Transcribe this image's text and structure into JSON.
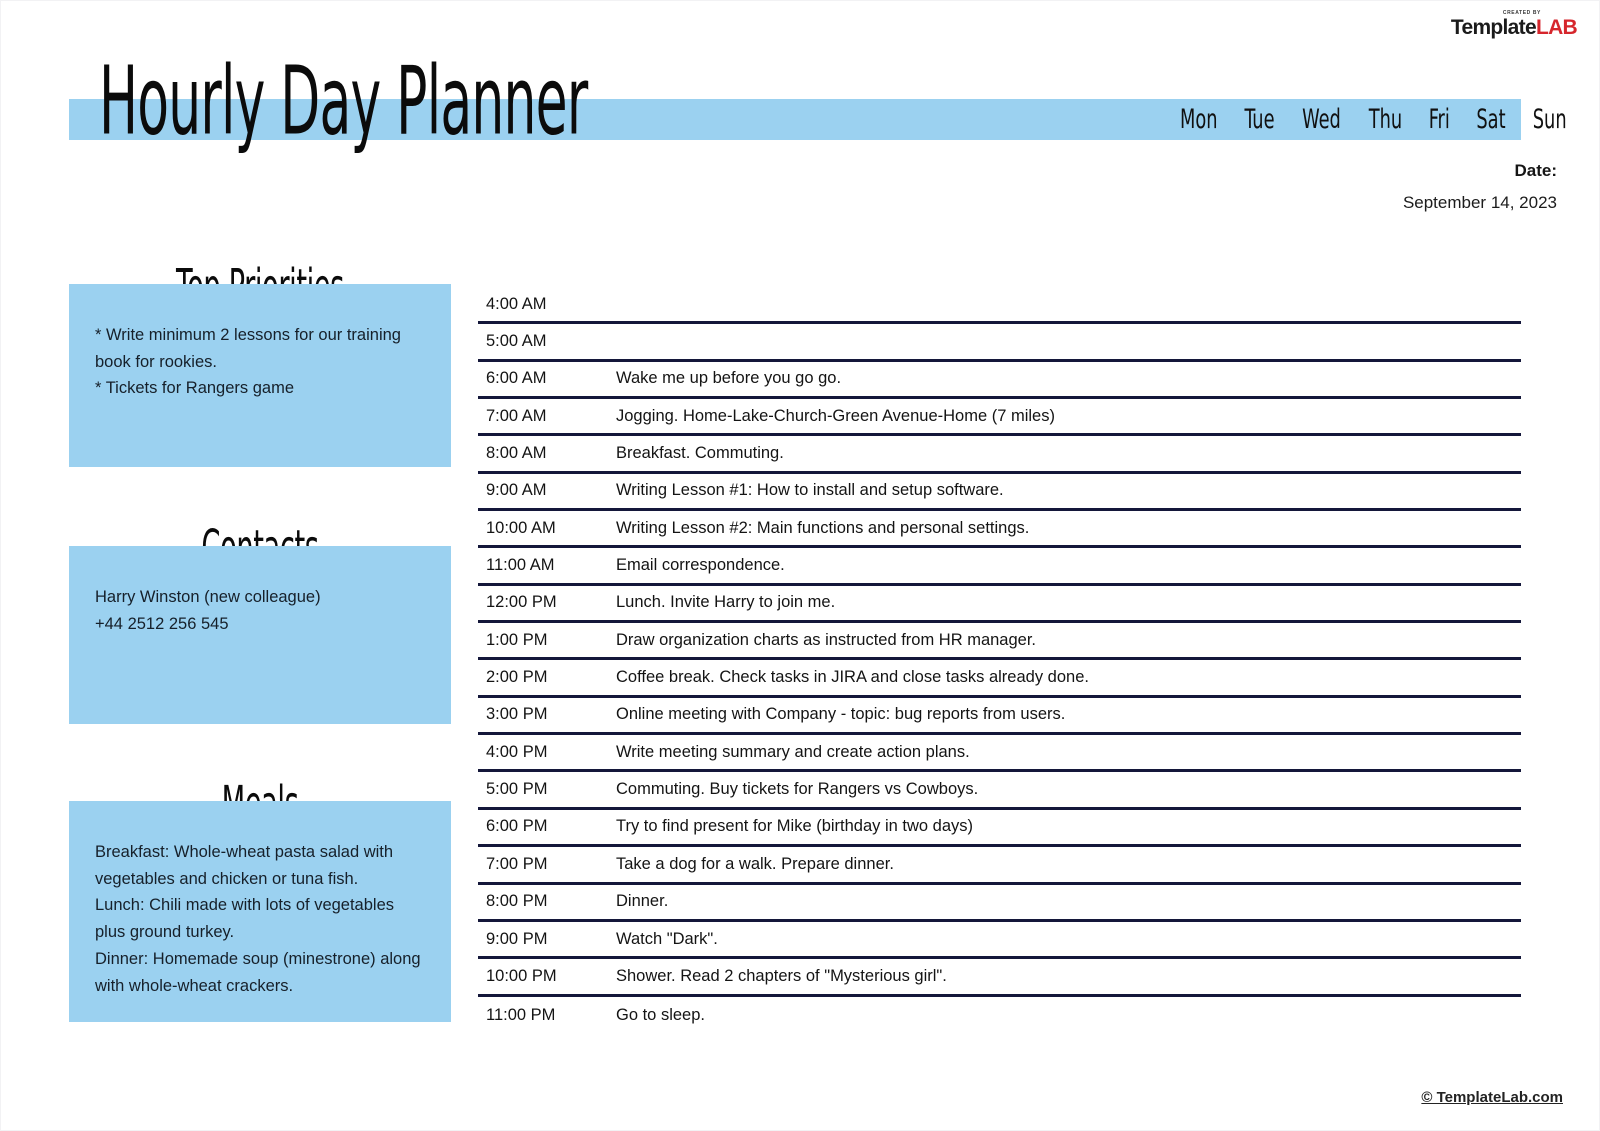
{
  "brand": {
    "created_by": "Created by",
    "name_primary": "Template",
    "name_accent": "LAB"
  },
  "header": {
    "title": "Hourly Day Planner",
    "days": [
      "Mon",
      "Tue",
      "Wed",
      "Thu",
      "Fri",
      "Sat",
      "Sun"
    ],
    "date_label": "Date:",
    "date_value": "September 14, 2023"
  },
  "panels": {
    "priorities": {
      "heading": "Top Priorities",
      "body": "* Write minimum 2 lessons for our training book for rookies.\n* Tickets for Rangers game"
    },
    "contacts": {
      "heading": "Contacts",
      "body": "Harry Winston (new colleague)\n+44 2512 256 545"
    },
    "meals": {
      "heading": "Meals",
      "body": "Breakfast: Whole-wheat pasta salad with vegetables and chicken or tuna fish.\nLunch: Chili made with lots of vegetables plus ground turkey.\nDinner: Homemade soup (minestrone) along with whole-wheat crackers."
    }
  },
  "schedule": {
    "rows": [
      {
        "time": "4:00 AM",
        "task": ""
      },
      {
        "time": "5:00 AM",
        "task": ""
      },
      {
        "time": "6:00 AM",
        "task": "Wake me up before you go go."
      },
      {
        "time": "7:00 AM",
        "task": "Jogging. Home-Lake-Church-Green Avenue-Home (7 miles)"
      },
      {
        "time": "8:00 AM",
        "task": "Breakfast. Commuting."
      },
      {
        "time": "9:00 AM",
        "task": "Writing Lesson #1: How to install and setup software."
      },
      {
        "time": "10:00 AM",
        "task": "Writing Lesson #2: Main functions and personal settings."
      },
      {
        "time": "11:00 AM",
        "task": "Email correspondence."
      },
      {
        "time": "12:00 PM",
        "task": "Lunch. Invite Harry to join me."
      },
      {
        "time": "1:00 PM",
        "task": "Draw organization charts as instructed from HR manager."
      },
      {
        "time": "2:00 PM",
        "task": "Coffee break. Check tasks in JIRA and close tasks already done."
      },
      {
        "time": "3:00 PM",
        "task": "Online meeting with Company - topic: bug reports from users."
      },
      {
        "time": "4:00 PM",
        "task": "Write meeting summary and create action plans."
      },
      {
        "time": "5:00 PM",
        "task": "Commuting. Buy tickets for Rangers vs Cowboys."
      },
      {
        "time": "6:00 PM",
        "task": "Try to find present for Mike (birthday in two days)"
      },
      {
        "time": "7:00 PM",
        "task": "Take a dog for a walk. Prepare dinner."
      },
      {
        "time": "8:00 PM",
        "task": "Dinner."
      },
      {
        "time": "9:00 PM",
        "task": "Watch \"Dark\"."
      },
      {
        "time": "10:00 PM",
        "task": "Shower. Read 2 chapters of \"Mysterious girl\"."
      },
      {
        "time": "11:00 PM",
        "task": "Go to sleep."
      }
    ]
  },
  "footer": {
    "copyright": "© TemplateLab.com"
  },
  "colors": {
    "accent_blue": "#9bd1f0",
    "rule_navy": "#14173a",
    "brand_red": "#d6262c"
  }
}
